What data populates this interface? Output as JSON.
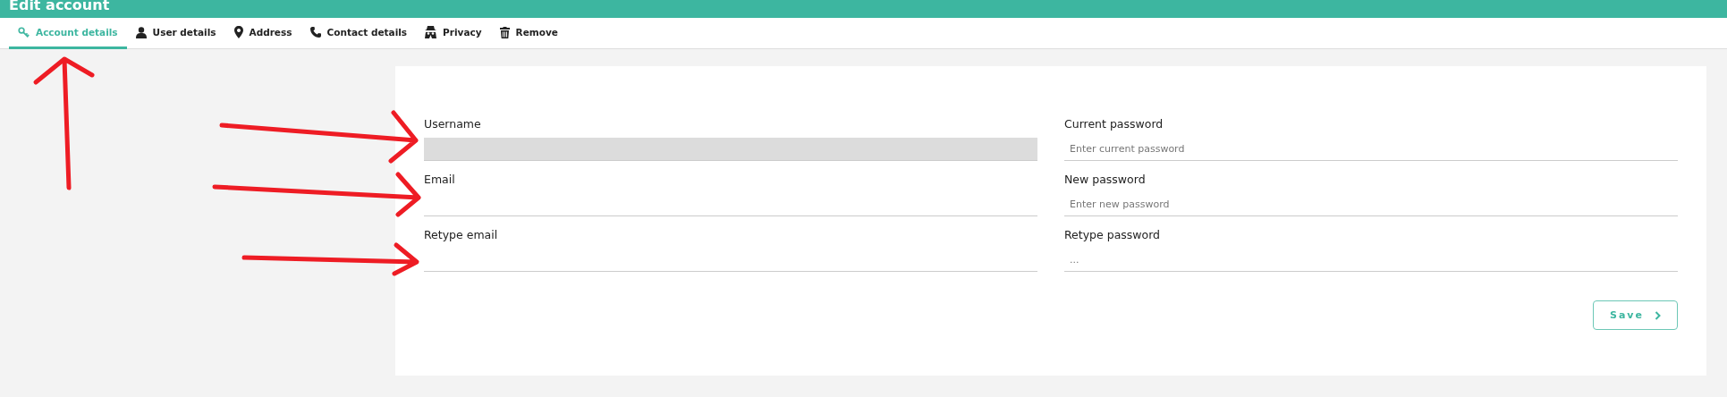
{
  "header": {
    "title": "Edit account"
  },
  "tabs": [
    {
      "label": "Account details",
      "kind": "key",
      "selected": true
    },
    {
      "label": "User details",
      "kind": "user",
      "selected": false
    },
    {
      "label": "Address",
      "kind": "pin",
      "selected": false
    },
    {
      "label": "Contact details",
      "kind": "phone",
      "selected": false
    },
    {
      "label": "Privacy",
      "kind": "spy",
      "selected": false
    },
    {
      "label": "Remove",
      "kind": "trash",
      "selected": false
    }
  ],
  "form": {
    "left_fields": [
      {
        "label": "Username",
        "disabled": true
      },
      {
        "label": "Email",
        "disabled": false
      },
      {
        "label": "Retype email",
        "disabled": false
      }
    ],
    "right_fields": [
      {
        "label": "Current password",
        "placeholder": "Enter current password",
        "disabled": false
      },
      {
        "label": "New password",
        "placeholder": "Enter new password",
        "disabled": false
      },
      {
        "label": "Retype password",
        "placeholder": "...",
        "disabled": false
      }
    ],
    "save_button": {
      "label": "Save"
    }
  }
}
